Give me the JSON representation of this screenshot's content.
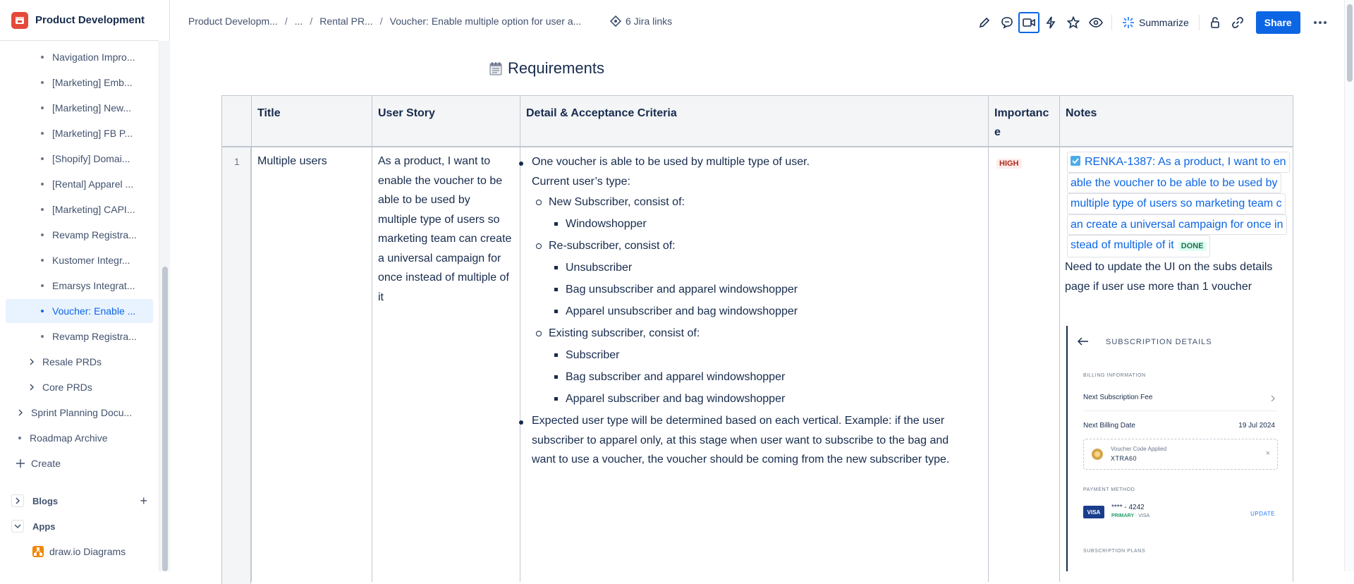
{
  "space": {
    "title": "Product Development"
  },
  "sidebar": {
    "items": [
      {
        "label": "Navigation Impro...",
        "active": false
      },
      {
        "label": "[Marketing] Emb...",
        "active": false
      },
      {
        "label": "[Marketing] New...",
        "active": false
      },
      {
        "label": "[Marketing] FB P...",
        "active": false
      },
      {
        "label": "[Shopify] Domai...",
        "active": false
      },
      {
        "label": "[Rental] Apparel ...",
        "active": false
      },
      {
        "label": "[Marketing] CAPI...",
        "active": false
      },
      {
        "label": "Revamp Registra...",
        "active": false
      },
      {
        "label": "Kustomer Integr...",
        "active": false
      },
      {
        "label": "Emarsys Integrat...",
        "active": false
      },
      {
        "label": "Voucher: Enable ...",
        "active": true
      },
      {
        "label": "Revamp Registra...",
        "active": false
      }
    ],
    "folders": [
      {
        "label": "Resale PRDs"
      },
      {
        "label": "Core PRDs"
      }
    ],
    "top_level": [
      {
        "label": "Sprint Planning Docu..."
      },
      {
        "label": "Roadmap Archive"
      }
    ],
    "create_label": "Create",
    "blogs_label": "Blogs",
    "apps_label": "Apps",
    "app_item": "draw.io Diagrams"
  },
  "breadcrumb": {
    "items": [
      "Product Developm...",
      "...",
      "Rental PR...",
      "Voucher: Enable multiple option for user a..."
    ],
    "separator": "/"
  },
  "jira_links": "6 Jira links",
  "toolbar": {
    "summarize_label": "Summarize",
    "share_label": "Share"
  },
  "page": {
    "heading": "Requirements"
  },
  "table": {
    "headers": [
      "Title",
      "User Story",
      "Detail & Acceptance Criteria",
      "Importanc",
      "e",
      "Notes"
    ],
    "row": {
      "number": "1",
      "title": "Multiple users",
      "user_story": [
        "As a product, I want to",
        "enable the voucher to be",
        "able to be used by",
        "multiple type of users so",
        "marketing team can create",
        "a universal campaign for",
        "once instead of multiple of",
        "it"
      ],
      "criteria": {
        "c1": "One voucher is able to be used by multiple type of user.",
        "c1b": "Current user’s type:",
        "new_sub": "New Subscriber, consist of:",
        "windowshopper": "Windowshopper",
        "re_sub": "Re-subscriber, consist of:",
        "unsub": "Unsubscriber",
        "bag_unsub": "Bag unsubscriber and apparel windowshopper",
        "app_unsub": "Apparel unsubscriber and bag windowshopper",
        "existing": "Existing subscriber, consist of:",
        "subscriber": "Subscriber",
        "bag_sub": "Bag subscriber and apparel windowshopper",
        "app_sub": "Apparel subscriber and bag windowshopper",
        "c2_1": "Expected user type will be determined based on each vertical. Example: if the user",
        "c2_2": "subscriber to apparel only, at this stage when user want to subscribe to the bag and",
        "c2_3": "want to use a voucher, the voucher should be coming from the new subscriber type."
      },
      "importance": "HIGH",
      "notes": {
        "jira_lines": [
          "RENKA-1387: As a product, I want to en",
          "able the voucher to be able to be used by",
          "multiple type of users so marketing team c",
          "an create a universal campaign for once in",
          "stead of multiple of it"
        ],
        "jira_status": "DONE",
        "text": [
          "Need to update the UI on the subs details",
          "page if user use more than 1 voucher"
        ]
      }
    }
  },
  "embedded_screenshot": {
    "title": "SUBSCRIPTION DETAILS",
    "billing_label": "BILLING INFORMATION",
    "next_fee": "Next Subscription Fee",
    "next_billing": "Next Billing Date",
    "next_billing_value": "19 Jul 2024",
    "voucher_label": "Voucher Code Applied",
    "voucher_code": "XTRA60",
    "payment_label": "PAYMENT METHOD",
    "card": "**** - 4242",
    "card_primary": "PRIMARY",
    "card_brand": "· VISA",
    "visa": "VISA",
    "update": "UPDATE",
    "plans_label": "SUBSCRIPTION PLANS"
  },
  "colors": {
    "accent": "#0c66e4",
    "space_logo": "#e5493a",
    "high": "#ae2a19",
    "done": "#216e4e"
  }
}
